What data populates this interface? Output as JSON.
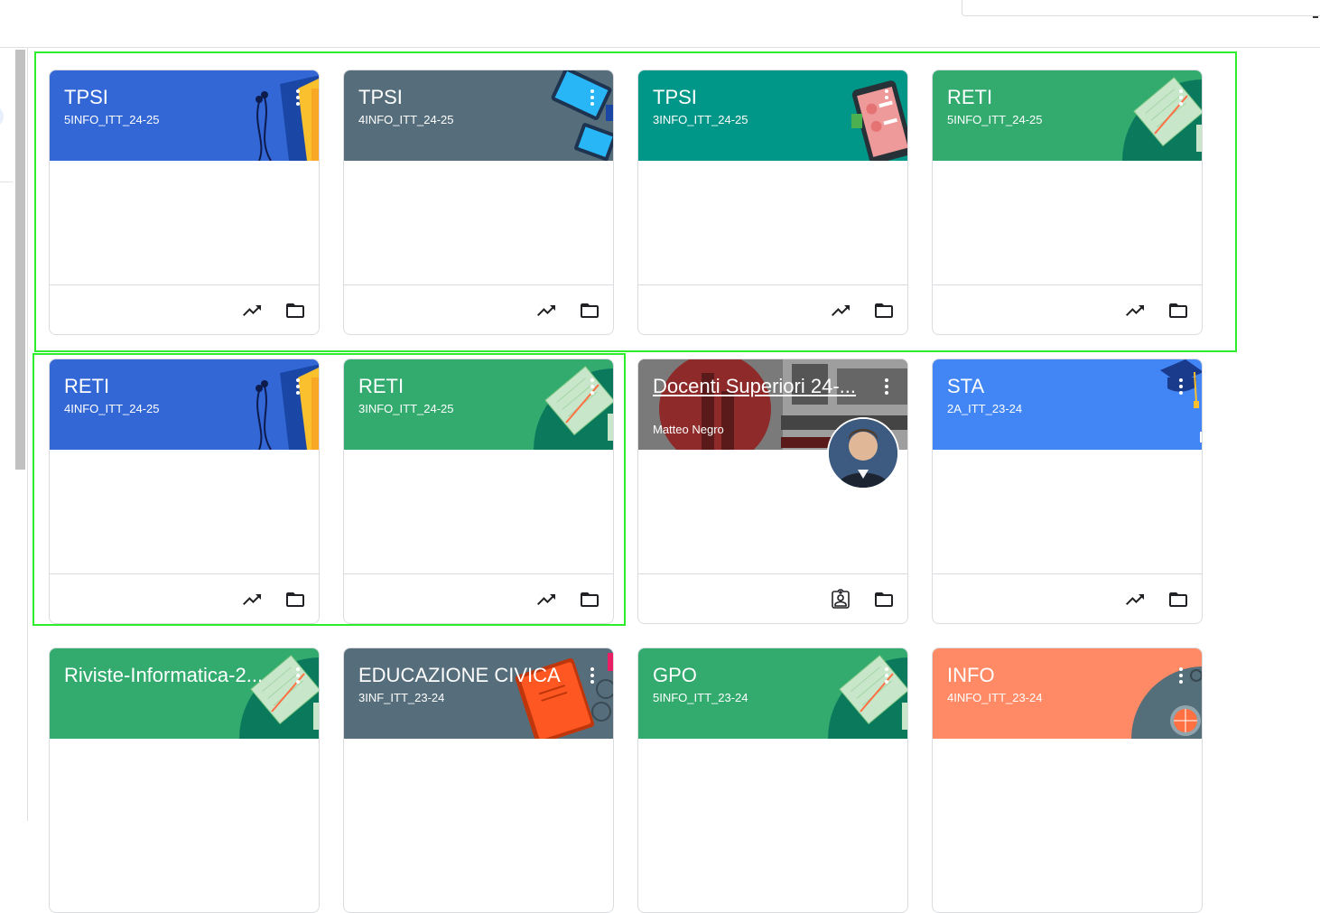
{
  "colors": {
    "blue": "#3367d6",
    "slate": "#566e7b",
    "teal": "#009688",
    "green": "#33ab6f",
    "bright_blue": "#4285f4",
    "orange": "#ff8a65",
    "selection": "#2ded2d"
  },
  "cards": [
    {
      "title": "TPSI",
      "section": "5INFO_ITT_24-25",
      "theme": "blue",
      "art": "headphones-book",
      "footer_icons": [
        "trending-up-icon",
        "folder-icon"
      ]
    },
    {
      "title": "TPSI",
      "section": "4INFO_ITT_24-25",
      "theme": "slate",
      "art": "tablets",
      "footer_icons": [
        "trending-up-icon",
        "folder-icon"
      ]
    },
    {
      "title": "TPSI",
      "section": "3INFO_ITT_24-25",
      "theme": "teal",
      "art": "phone",
      "footer_icons": [
        "trending-up-icon",
        "folder-icon"
      ]
    },
    {
      "title": "RETI",
      "section": "5INFO_ITT_24-25",
      "theme": "green",
      "art": "notebook",
      "footer_icons": [
        "trending-up-icon",
        "folder-icon"
      ]
    },
    {
      "title": "RETI",
      "section": "4INFO_ITT_24-25",
      "theme": "blue",
      "art": "headphones-book",
      "footer_icons": [
        "trending-up-icon",
        "folder-icon"
      ]
    },
    {
      "title": "RETI",
      "section": "3INFO_ITT_24-25",
      "theme": "green",
      "art": "notebook",
      "footer_icons": [
        "trending-up-icon",
        "folder-icon"
      ]
    },
    {
      "title": "Docenti Superiori 24-...",
      "section": "",
      "owner": "Matteo Negro",
      "theme": "photo",
      "art": "salesiani-photo",
      "footer_icons": [
        "assignment-ind-icon",
        "folder-icon"
      ]
    },
    {
      "title": "STA",
      "section": "2A_ITT_23-24",
      "theme": "bright_blue",
      "art": "graduation-cap",
      "footer_icons": [
        "trending-up-icon",
        "folder-icon"
      ]
    },
    {
      "title": "Riviste-Informatica-2...",
      "section": "",
      "theme": "green",
      "art": "notebook",
      "footer_icons": [
        "trending-up-icon",
        "folder-icon"
      ]
    },
    {
      "title": "EDUCAZIONE CIVICA",
      "section": "3INF_ITT_23-24",
      "theme": "slate",
      "art": "red-book",
      "footer_icons": [
        "trending-up-icon",
        "folder-icon"
      ]
    },
    {
      "title": "GPO",
      "section": "5INFO_ITT_23-24",
      "theme": "green",
      "art": "notebook",
      "footer_icons": [
        "trending-up-icon",
        "folder-icon"
      ]
    },
    {
      "title": "INFO",
      "section": "4INFO_ITT_23-24",
      "theme": "orange",
      "art": "ball",
      "footer_icons": [
        "trending-up-icon",
        "folder-icon"
      ]
    }
  ]
}
